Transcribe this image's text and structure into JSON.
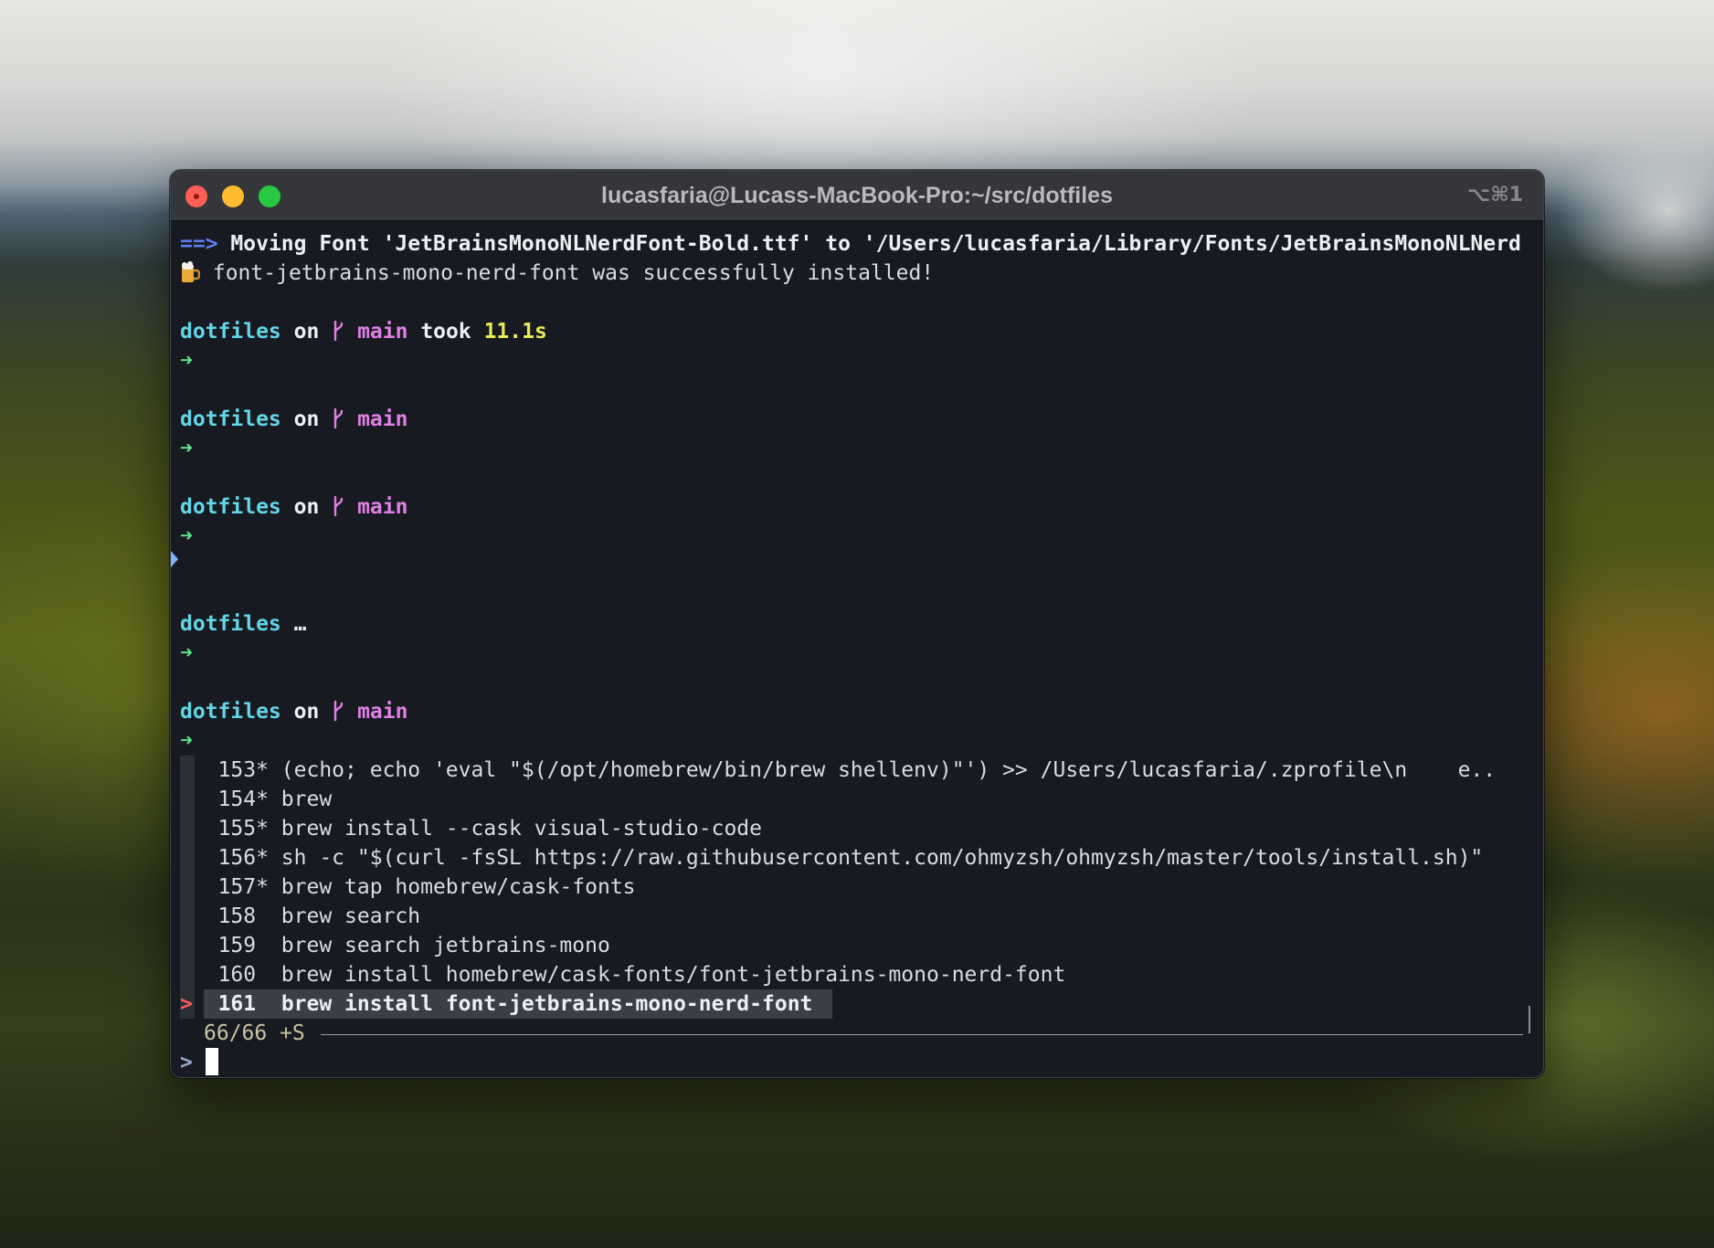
{
  "window": {
    "title": "lucasfaria@Lucass-MacBook-Pro:~/src/dotfiles",
    "shortcut": "⌥⌘1"
  },
  "colors": {
    "arrow_blue": "#5d7cf0",
    "dir_cyan": "#63d5e8",
    "branch_magenta": "#e07fe3",
    "duration_yellow": "#e9e85a",
    "prompt_green": "#5fe08a",
    "pointer_red": "#ff5a5a",
    "terminal_bg": "#171b21"
  },
  "output": {
    "move_arrow": "==>",
    "move_text": "Moving Font 'JetBrainsMonoNLNerdFont-Bold.ttf' to '/Users/lucasfaria/Library/Fonts/JetBrainsMonoNLNerd",
    "beer_icon": "beer-mug-icon",
    "success_text": "font-jetbrains-mono-nerd-font was successfully installed!"
  },
  "prompts": {
    "dir": "dotfiles",
    "on": "on",
    "branch": "main",
    "branch_icon": "git-branch-icon",
    "took": "took",
    "duration": "11.1s",
    "arrow": "➜",
    "ellipsis": "…"
  },
  "fzf": {
    "items": [
      {
        "num": "153*",
        "cmd": "(echo; echo 'eval \"$(/opt/homebrew/bin/brew shellenv)\"') >> /Users/lucasfaria/.zprofile\\n    e.."
      },
      {
        "num": "154*",
        "cmd": "brew"
      },
      {
        "num": "155*",
        "cmd": "brew install --cask visual-studio-code"
      },
      {
        "num": "156*",
        "cmd": "sh -c \"$(curl -fsSL https://raw.githubusercontent.com/ohmyzsh/ohmyzsh/master/tools/install.sh)\""
      },
      {
        "num": "157*",
        "cmd": "brew tap homebrew/cask-fonts"
      },
      {
        "num": "158 ",
        "cmd": "brew search"
      },
      {
        "num": "159 ",
        "cmd": "brew search jetbrains-mono"
      },
      {
        "num": "160 ",
        "cmd": "brew install homebrew/cask-fonts/font-jetbrains-mono-nerd-font"
      },
      {
        "num": "161 ",
        "cmd": "brew install font-jetbrains-mono-nerd-font"
      }
    ],
    "pointer": ">",
    "info": "66/66 +S",
    "query_prompt": ">",
    "query": ""
  }
}
